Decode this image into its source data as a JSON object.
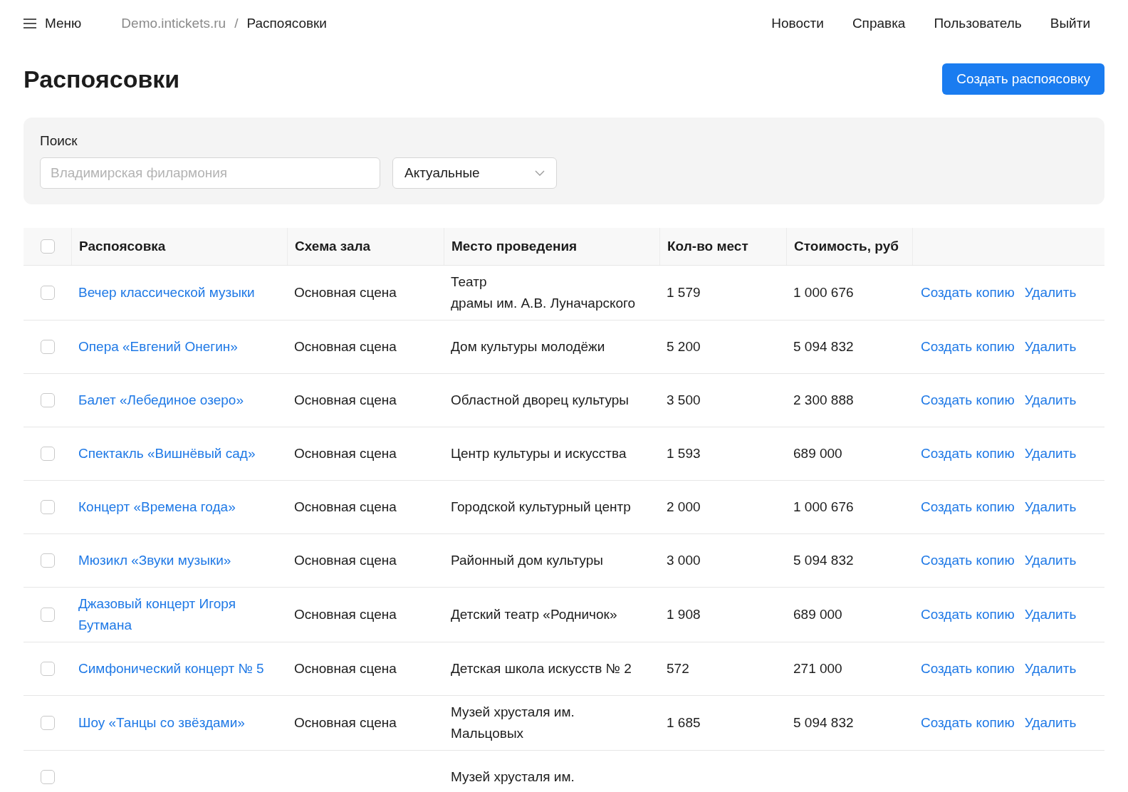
{
  "nav": {
    "menu_label": "Меню",
    "breadcrumbs": [
      {
        "label": "Demo.intickets.ru",
        "current": false
      },
      {
        "label": "Распоясовки",
        "current": true
      }
    ],
    "breadcrumb_separator": "/",
    "links": [
      "Новости",
      "Справка",
      "Пользователь",
      "Выйти"
    ]
  },
  "page": {
    "title": "Распоясовки",
    "create_button": "Создать распоясовку"
  },
  "filter": {
    "label": "Поиск",
    "search": {
      "placeholder": "Владимирская филармония"
    },
    "status_select": {
      "value": "Актуальные"
    }
  },
  "table": {
    "select_all": {
      "checked": false
    },
    "columns": [
      "Распоясовка",
      "Схема зала",
      "Место проведения",
      "Кол-во мест",
      "Стоимость, руб"
    ],
    "rows": [
      {
        "selected": false,
        "name": "Вечер классической музыки",
        "scheme": "Основная сцена",
        "venue": "Театр\nдрамы им. А.В. Луначарского",
        "seats": "1 579",
        "cost": "1 000 676",
        "actions": [
          "Создать копию",
          "Удалить"
        ]
      },
      {
        "selected": false,
        "name": "Опера «Евгений Онегин»",
        "scheme": "Основная сцена",
        "venue": "Дом культуры молодёжи",
        "seats": "5 200",
        "cost": "5 094 832",
        "actions": [
          "Создать копию",
          "Удалить"
        ]
      },
      {
        "selected": false,
        "name": "Балет «Лебединое озеро»",
        "scheme": "Основная сцена",
        "venue": "Областной дворец культуры",
        "seats": "3 500",
        "cost": "2 300 888",
        "actions": [
          "Создать копию",
          "Удалить"
        ]
      },
      {
        "selected": false,
        "name": "Спектакль «Вишнёвый сад»",
        "scheme": "Основная сцена",
        "venue": "Центр культуры и искусства",
        "seats": "1 593",
        "cost": "689 000",
        "actions": [
          "Создать копию",
          "Удалить"
        ]
      },
      {
        "selected": false,
        "name": "Концерт «Времена года»",
        "scheme": "Основная сцена",
        "venue": "Городской культурный центр",
        "seats": "2 000",
        "cost": "1 000 676",
        "actions": [
          "Создать копию",
          "Удалить"
        ]
      },
      {
        "selected": false,
        "name": "Мюзикл «Звуки музыки»",
        "scheme": "Основная сцена",
        "venue": "Районный дом культуры",
        "seats": "3 000",
        "cost": "5 094 832",
        "actions": [
          "Создать копию",
          "Удалить"
        ]
      },
      {
        "selected": false,
        "name": "Джазовый концерт Игоря Бутмана",
        "scheme": "Основная сцена",
        "venue": "Детский театр «Родничок»",
        "seats": "1 908",
        "cost": "689 000",
        "actions": [
          "Создать копию",
          "Удалить"
        ]
      },
      {
        "selected": false,
        "name": "Симфонический концерт № 5",
        "scheme": "Основная сцена",
        "venue": "Детская школа искусств № 2",
        "seats": "572",
        "cost": "271 000",
        "actions": [
          "Создать копию",
          "Удалить"
        ]
      },
      {
        "selected": false,
        "name": "Шоу «Танцы со звёздами»",
        "scheme": "Основная сцена",
        "venue": "Музей хрусталя им.\nМальцовых",
        "seats": "1 685",
        "cost": "5 094 832",
        "actions": [
          "Создать копию",
          "Удалить"
        ]
      },
      {
        "selected": false,
        "venue": "Музей хрусталя им."
      }
    ]
  }
}
